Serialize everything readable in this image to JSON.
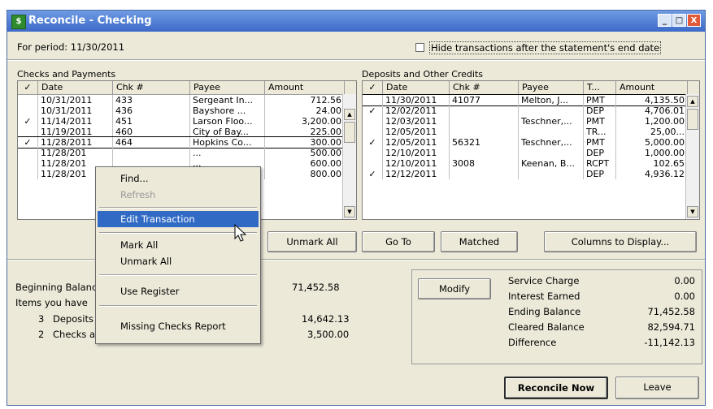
{
  "window": {
    "title": "Reconcile - Checking",
    "controls": [
      "_",
      "□",
      "X"
    ]
  },
  "period": "For period: 11/30/2011",
  "hide_checkbox": {
    "label": "Hide transactions after the statement's end date",
    "checked": false
  },
  "checks": {
    "title": "Checks and Payments",
    "columns": [
      "✓",
      "Date",
      "Chk #",
      "Payee",
      "Amount"
    ],
    "rows": [
      {
        "check": "",
        "date": "10/31/2011",
        "num": "433",
        "payee": "Sergeant In...",
        "amount": "712.56"
      },
      {
        "check": "",
        "date": "10/31/2011",
        "num": "436",
        "payee": "Bayshore ...",
        "amount": "24.00"
      },
      {
        "check": "✓",
        "date": "11/14/2011",
        "num": "451",
        "payee": "Larson Floo...",
        "amount": "3,200.00"
      },
      {
        "check": "",
        "date": "11/19/2011",
        "num": "460",
        "payee": "City of Bay...",
        "amount": "225.00"
      },
      {
        "check": "✓",
        "date": "11/28/2011",
        "num": "464",
        "payee": "Hopkins Co...",
        "amount": "300.00"
      },
      {
        "check": "",
        "date": "11/28/201",
        "num": "",
        "payee": "...",
        "amount": "500.00"
      },
      {
        "check": "",
        "date": "11/28/201",
        "num": "",
        "payee": "...",
        "amount": "600.00"
      },
      {
        "check": "",
        "date": "11/28/201",
        "num": "",
        "payee": "g",
        "amount": "800.00"
      }
    ]
  },
  "deposits": {
    "title": "Deposits and Other Credits",
    "columns": [
      "✓",
      "Date",
      "Chk #",
      "Payee",
      "T...",
      "Amount"
    ],
    "rows": [
      {
        "check": "",
        "date": "11/30/2011",
        "num": "41077",
        "payee": "Melton, J...",
        "type": "PMT",
        "amount": "4,135.50"
      },
      {
        "check": "✓",
        "date": "12/02/2011",
        "num": "",
        "payee": "",
        "type": "DEP",
        "amount": "4,706.01"
      },
      {
        "check": "",
        "date": "12/03/2011",
        "num": "",
        "payee": "Teschner,...",
        "type": "PMT",
        "amount": "1,200.00"
      },
      {
        "check": "",
        "date": "12/05/2011",
        "num": "",
        "payee": "",
        "type": "TR...",
        "amount": "25,00..."
      },
      {
        "check": "✓",
        "date": "12/05/2011",
        "num": "56321",
        "payee": "Teschner,...",
        "type": "PMT",
        "amount": "5,000.00"
      },
      {
        "check": "",
        "date": "12/10/2011",
        "num": "",
        "payee": "",
        "type": "DEP",
        "amount": "1,000.00"
      },
      {
        "check": "",
        "date": "12/10/2011",
        "num": "3008",
        "payee": "Keenan, B...",
        "type": "RCPT",
        "amount": "102.65"
      },
      {
        "check": "✓",
        "date": "12/12/2011",
        "num": "",
        "payee": "",
        "type": "DEP",
        "amount": "4,936.12"
      }
    ]
  },
  "buttons": {
    "unmark_all": "Unmark All",
    "go_to": "Go To",
    "matched": "Matched",
    "columns": "Columns to Display...",
    "modify": "Modify",
    "reconcile": "Reconcile Now",
    "leave": "Leave"
  },
  "summary": {
    "beginning_label": "Beginning Balanc",
    "beginning_value": "71,452.58",
    "items_label": "Items you have",
    "deposits_count": "3",
    "deposits_label": "Deposits",
    "deposits_value": "14,642.13",
    "checks_count": "2",
    "checks_label": "Checks a",
    "checks_value": "3,500.00"
  },
  "balances": [
    {
      "label": "Service Charge",
      "value": "0.00"
    },
    {
      "label": "Interest Earned",
      "value": "0.00"
    },
    {
      "label": "Ending Balance",
      "value": "71,452.58"
    },
    {
      "label": "Cleared Balance",
      "value": "82,594.71"
    },
    {
      "label": "Difference",
      "value": "-11,142.13"
    }
  ],
  "context_menu": {
    "find": "Find...",
    "refresh": "Refresh",
    "edit": "Edit Transaction",
    "mark_all": "Mark All",
    "unmark_all": "Unmark All",
    "use_register": "Use Register",
    "missing_checks": "Missing Checks Report"
  }
}
